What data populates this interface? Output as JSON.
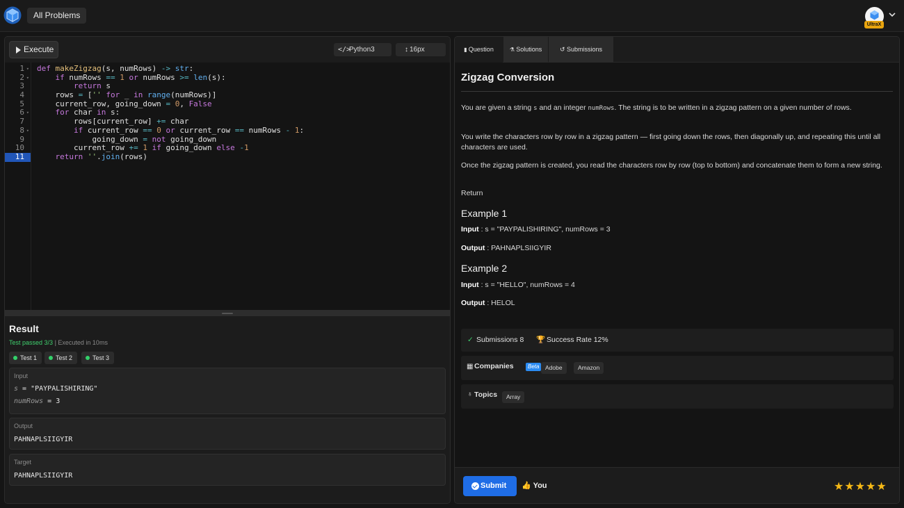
{
  "topbar": {
    "nav_button": "All Problems",
    "badge": "UltraX"
  },
  "toolbar": {
    "execute_label": "Execute",
    "language": "Python3",
    "font_size": "16px"
  },
  "editor": {
    "line_numbers": [
      "1",
      "2",
      "3",
      "4",
      "5",
      "6",
      "7",
      "8",
      "9",
      "10",
      "11"
    ],
    "active_line": 11
  },
  "result": {
    "title": "Result",
    "status": "Test passed 3/3",
    "time": "| Executed in 10ms",
    "tests": [
      "Test 1",
      "Test 2",
      "Test 3"
    ],
    "input_label": "Input",
    "input_s_var": "s",
    "input_s_eq": " = ",
    "input_s_val": "\"PAYPALISHIRING\"",
    "input_rows_var": "numRows",
    "input_rows_eq": " = ",
    "input_rows_val": "3",
    "output_label": "Output",
    "output_value": "PAHNAPLSIIGYIR",
    "target_label": "Target",
    "target_value": "PAHNAPLSIIGYIR"
  },
  "question": {
    "tabs": [
      "Question",
      "Solutions",
      "Submissions"
    ],
    "title": "Zigzag Conversion",
    "p1_a": "You are given a string ",
    "p1_code1": "s",
    "p1_b": " and an integer ",
    "p1_code2": "numRows",
    "p1_c": ". The string is to be written in a zigzag pattern on a given number of rows.",
    "p2": "You write the characters row by row in a zigzag pattern — first going down the rows, then diagonally up, and repeating this until all characters are used.",
    "p3": "Once the zigzag pattern is created, you read the characters row by row (top to bottom) and concatenate them to form a new string.",
    "p4": "Return",
    "example1_title": "Example 1",
    "example1_input_label": "Input",
    "example1_input": " : s = \"PAYPALISHIRING\", numRows = 3",
    "example1_output_label": "Output",
    "example1_output": " : PAHNAPLSIIGYIR",
    "example2_title": "Example 2",
    "example2_input_label": "Input",
    "example2_input": " : s = \"HELLO\", numRows = 4",
    "example2_output_label": "Output",
    "example2_output": " : HELOL",
    "submissions": "Submissions 8",
    "success_rate": "Success Rate 12%",
    "companies_label": "Companies",
    "beta": "Beta",
    "companies": [
      "Adobe",
      "Amazon"
    ],
    "topics_label": "Topics",
    "topics": [
      "Array"
    ]
  },
  "footer": {
    "submit_label": "Submit",
    "you_label": "You",
    "rating": 5,
    "stars_text": "★★★★★"
  },
  "colors": {
    "accent": "#1f6de6",
    "success": "#33d16a",
    "star": "#f5b816",
    "badge": "#e8a40e"
  }
}
